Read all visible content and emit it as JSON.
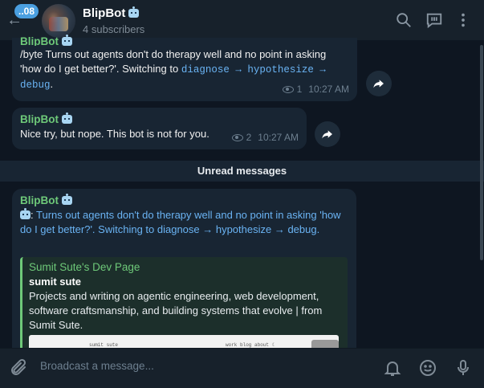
{
  "header": {
    "back_badge": "..08",
    "title": "BlipBot",
    "subtitle": "4 subscribers"
  },
  "messages": [
    {
      "sender": "BlipBot",
      "text_prefix": "/byte Turns out agents don't do therapy well and no point in asking 'how do I get better?'. Switching to ",
      "code": "diagnose → hypothesize → debug",
      "text_suffix": ".",
      "views": "1",
      "time": "10:27 AM"
    },
    {
      "sender": "BlipBot",
      "text": "Nice try, but nope. This bot is not for you.",
      "views": "2",
      "time": "10:27 AM"
    }
  ],
  "unread_label": "Unread messages",
  "unread_message": {
    "sender": "BlipBot",
    "prefix": ":",
    "link_text": "Turns out agents don't do therapy well and no point in asking 'how do I get better?'. Switching to diagnose → hypothesize → debug.",
    "preview": {
      "site": "Sumit Sute's Dev Page",
      "title": "sumit sute",
      "description": "Projects and writing on agentic engineering, web development, software craftsmanship, and building systems that evolve | from Sumit Sute.",
      "image_title": "sumit sute",
      "image_nav": "work  blog  about  ☾"
    }
  },
  "composer": {
    "placeholder": "Broadcast a message..."
  },
  "colors": {
    "background": "#0e1621",
    "bubble": "#182533",
    "accent": "#6ab3f3",
    "sender": "#6ec979"
  }
}
